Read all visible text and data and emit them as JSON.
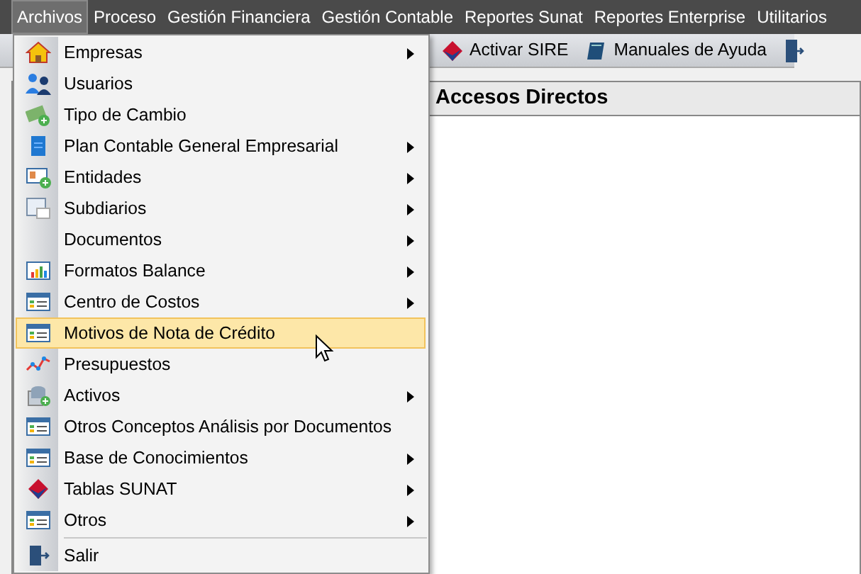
{
  "menubar": [
    {
      "label": "Archivos",
      "selected": true
    },
    {
      "label": "Proceso",
      "selected": false
    },
    {
      "label": "Gestión Financiera",
      "selected": false
    },
    {
      "label": "Gestión Contable",
      "selected": false
    },
    {
      "label": "Reportes Sunat",
      "selected": false
    },
    {
      "label": "Reportes Enterprise",
      "selected": false
    },
    {
      "label": "Utilitarios",
      "selected": false
    }
  ],
  "toolbar": [
    {
      "kind": "button",
      "label": "Activar SIRE"
    },
    {
      "kind": "button",
      "label": "Manuales de Ayuda"
    },
    {
      "kind": "icon"
    }
  ],
  "panel": {
    "title": "Accesos Directos"
  },
  "menu": [
    {
      "label": "Empresas",
      "submenu": true,
      "selected": false
    },
    {
      "label": "Usuarios",
      "submenu": false,
      "selected": false
    },
    {
      "label": "Tipo de Cambio",
      "submenu": false,
      "selected": false
    },
    {
      "label": "Plan Contable General Empresarial",
      "submenu": true,
      "selected": false
    },
    {
      "label": "Entidades",
      "submenu": true,
      "selected": false
    },
    {
      "label": "Subdiarios",
      "submenu": true,
      "selected": false
    },
    {
      "label": "Documentos",
      "submenu": true,
      "selected": false
    },
    {
      "label": "Formatos Balance",
      "submenu": true,
      "selected": false
    },
    {
      "label": "Centro de Costos",
      "submenu": true,
      "selected": false
    },
    {
      "label": "Motivos de Nota de Crédito",
      "submenu": false,
      "selected": true
    },
    {
      "label": "Presupuestos",
      "submenu": false,
      "selected": false
    },
    {
      "label": "Activos",
      "submenu": true,
      "selected": false
    },
    {
      "label": "Otros Conceptos Análisis por Documentos",
      "submenu": false,
      "selected": false
    },
    {
      "label": "Base de Conocimientos",
      "submenu": true,
      "selected": false
    },
    {
      "label": "Tablas SUNAT",
      "submenu": true,
      "selected": false
    },
    {
      "label": "Otros",
      "submenu": true,
      "selected": false
    },
    {
      "label": "Salir",
      "submenu": false,
      "selected": false,
      "separator_before": true
    }
  ]
}
